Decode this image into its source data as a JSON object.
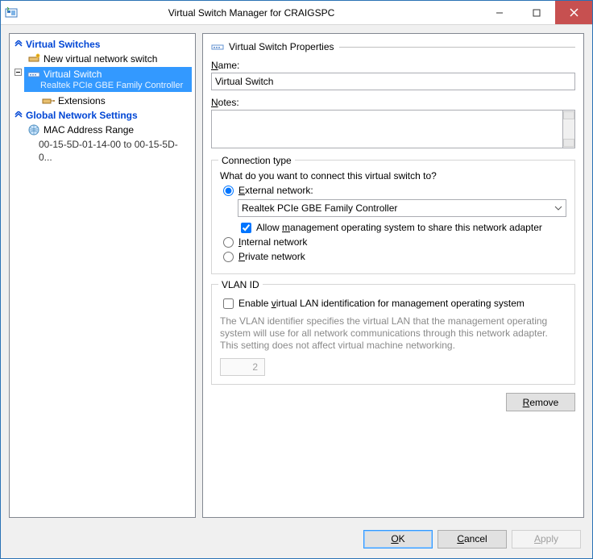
{
  "window": {
    "title": "Virtual Switch Manager for CRAIGSPC"
  },
  "tree": {
    "section_switches": "Virtual Switches",
    "new_switch": "New virtual network switch",
    "selected": {
      "name": "Virtual Switch",
      "sub": "Realtek PCIe GBE Family Controller"
    },
    "extensions": "Extensions",
    "section_global": "Global Network Settings",
    "mac_range": "MAC Address Range",
    "mac_range_sub": "00-15-5D-01-14-00 to 00-15-5D-0..."
  },
  "props": {
    "header": "Virtual Switch Properties",
    "name_label": "Name:",
    "name_value": "Virtual Switch",
    "notes_label": "Notes:",
    "conn_legend": "Connection type",
    "conn_q": "What do you want to connect this virtual switch to?",
    "external": "External network:",
    "external_adapter": "Realtek PCIe GBE Family Controller",
    "allow_mgmt": "Allow management operating system to share this network adapter",
    "internal": "Internal network",
    "private": "Private network",
    "vlan_legend": "VLAN ID",
    "vlan_check": "Enable virtual LAN identification for management operating system",
    "vlan_help": "The VLAN identifier specifies the virtual LAN that the management operating system will use for all network communications through this network adapter. This setting does not affect virtual machine networking.",
    "vlan_value": "2",
    "remove": "Remove"
  },
  "footer": {
    "ok": "OK",
    "cancel": "Cancel",
    "apply": "Apply"
  }
}
